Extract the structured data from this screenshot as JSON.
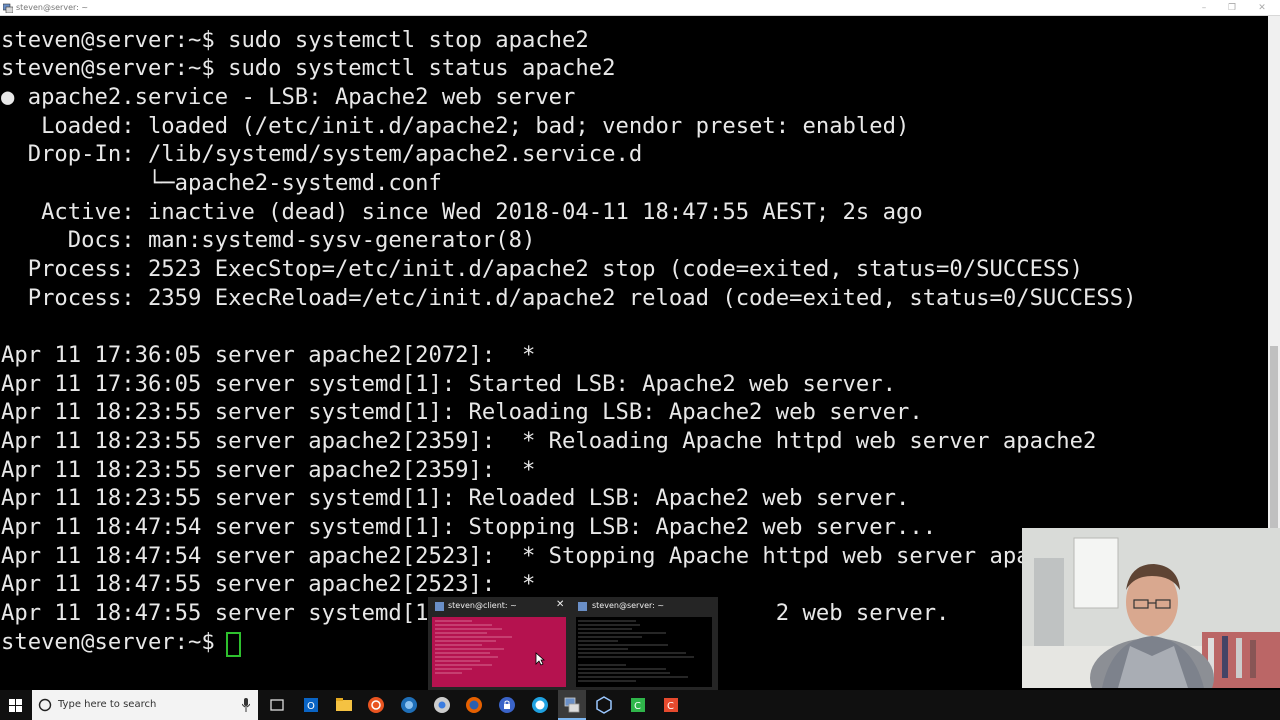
{
  "window": {
    "title": "steven@server: ~"
  },
  "terminal": {
    "lines": [
      "steven@server:~$ sudo systemctl stop apache2",
      "steven@server:~$ sudo systemctl status apache2",
      "● apache2.service - LSB: Apache2 web server",
      "   Loaded: loaded (/etc/init.d/apache2; bad; vendor preset: enabled)",
      "  Drop-In: /lib/systemd/system/apache2.service.d",
      "           └─apache2-systemd.conf",
      "   Active: inactive (dead) since Wed 2018-04-11 18:47:55 AEST; 2s ago",
      "     Docs: man:systemd-sysv-generator(8)",
      "  Process: 2523 ExecStop=/etc/init.d/apache2 stop (code=exited, status=0/SUCCESS)",
      "  Process: 2359 ExecReload=/etc/init.d/apache2 reload (code=exited, status=0/SUCCESS)",
      "",
      "Apr 11 17:36:05 server apache2[2072]:  *",
      "Apr 11 17:36:05 server systemd[1]: Started LSB: Apache2 web server.",
      "Apr 11 18:23:55 server systemd[1]: Reloading LSB: Apache2 web server.",
      "Apr 11 18:23:55 server apache2[2359]:  * Reloading Apache httpd web server apache2",
      "Apr 11 18:23:55 server apache2[2359]:  *",
      "Apr 11 18:23:55 server systemd[1]: Reloaded LSB: Apache2 web server.",
      "Apr 11 18:47:54 server systemd[1]: Stopping LSB: Apache2 web server...",
      "Apr 11 18:47:54 server apache2[2523]:  * Stopping Apache httpd web server apa",
      "Apr 11 18:47:55 server apache2[2523]:  *",
      "Apr 11 18:47:55 server systemd[1                          2 web server.",
      "steven@server:~$ "
    ]
  },
  "thumbnails": [
    {
      "title": "steven@client: ~",
      "close": "✕"
    },
    {
      "title": "steven@server: ~"
    }
  ],
  "taskbar": {
    "search_placeholder": "Type here to search",
    "icons": [
      "task-view-icon",
      "outlook-icon",
      "file-explorer-icon",
      "ubuntu-icon",
      "network-icon",
      "chrome-icon",
      "firefox-icon",
      "keepass-icon",
      "skype-icon",
      "putty-icon",
      "virtualbox-icon",
      "camtasia-icon",
      "recorder-icon"
    ]
  },
  "colors": {
    "terminal_bg": "#000000",
    "terminal_fg": "#e8e8e8",
    "cursor": "#2ec02e",
    "taskbar_bg": "#101010"
  }
}
